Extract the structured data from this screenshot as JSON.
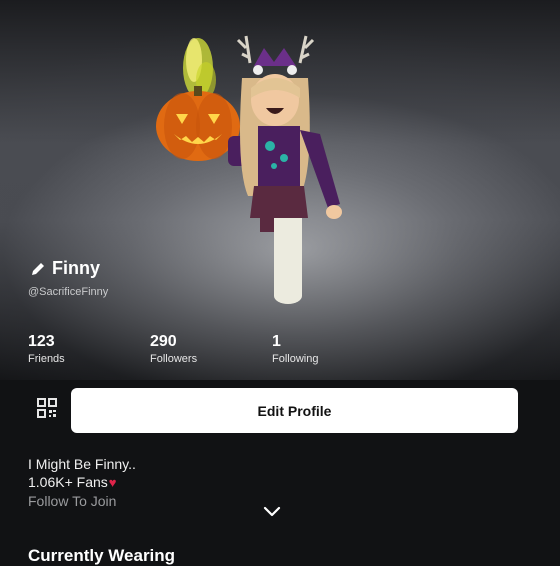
{
  "profile": {
    "display_name": "Finny",
    "username": "@SacrificeFinny"
  },
  "stats": [
    {
      "value": "123",
      "label": "Friends"
    },
    {
      "value": "290",
      "label": "Followers"
    },
    {
      "value": "1",
      "label": "Following"
    }
  ],
  "actions": {
    "edit_profile_label": "Edit Profile"
  },
  "bio": {
    "line1": "I Might Be Finny..",
    "line2": "1.06K+ Fans",
    "line3": "Follow To Join"
  },
  "sections": {
    "currently_wearing": "Currently Wearing"
  },
  "icons": {
    "name_icon": "pencil-icon",
    "qr": "qr-code-icon",
    "expand": "chevron-down-icon",
    "bio_emoji": "heart-icon"
  },
  "colors": {
    "background": "#111214",
    "button": "#ffffff",
    "heart": "#e0244a"
  }
}
